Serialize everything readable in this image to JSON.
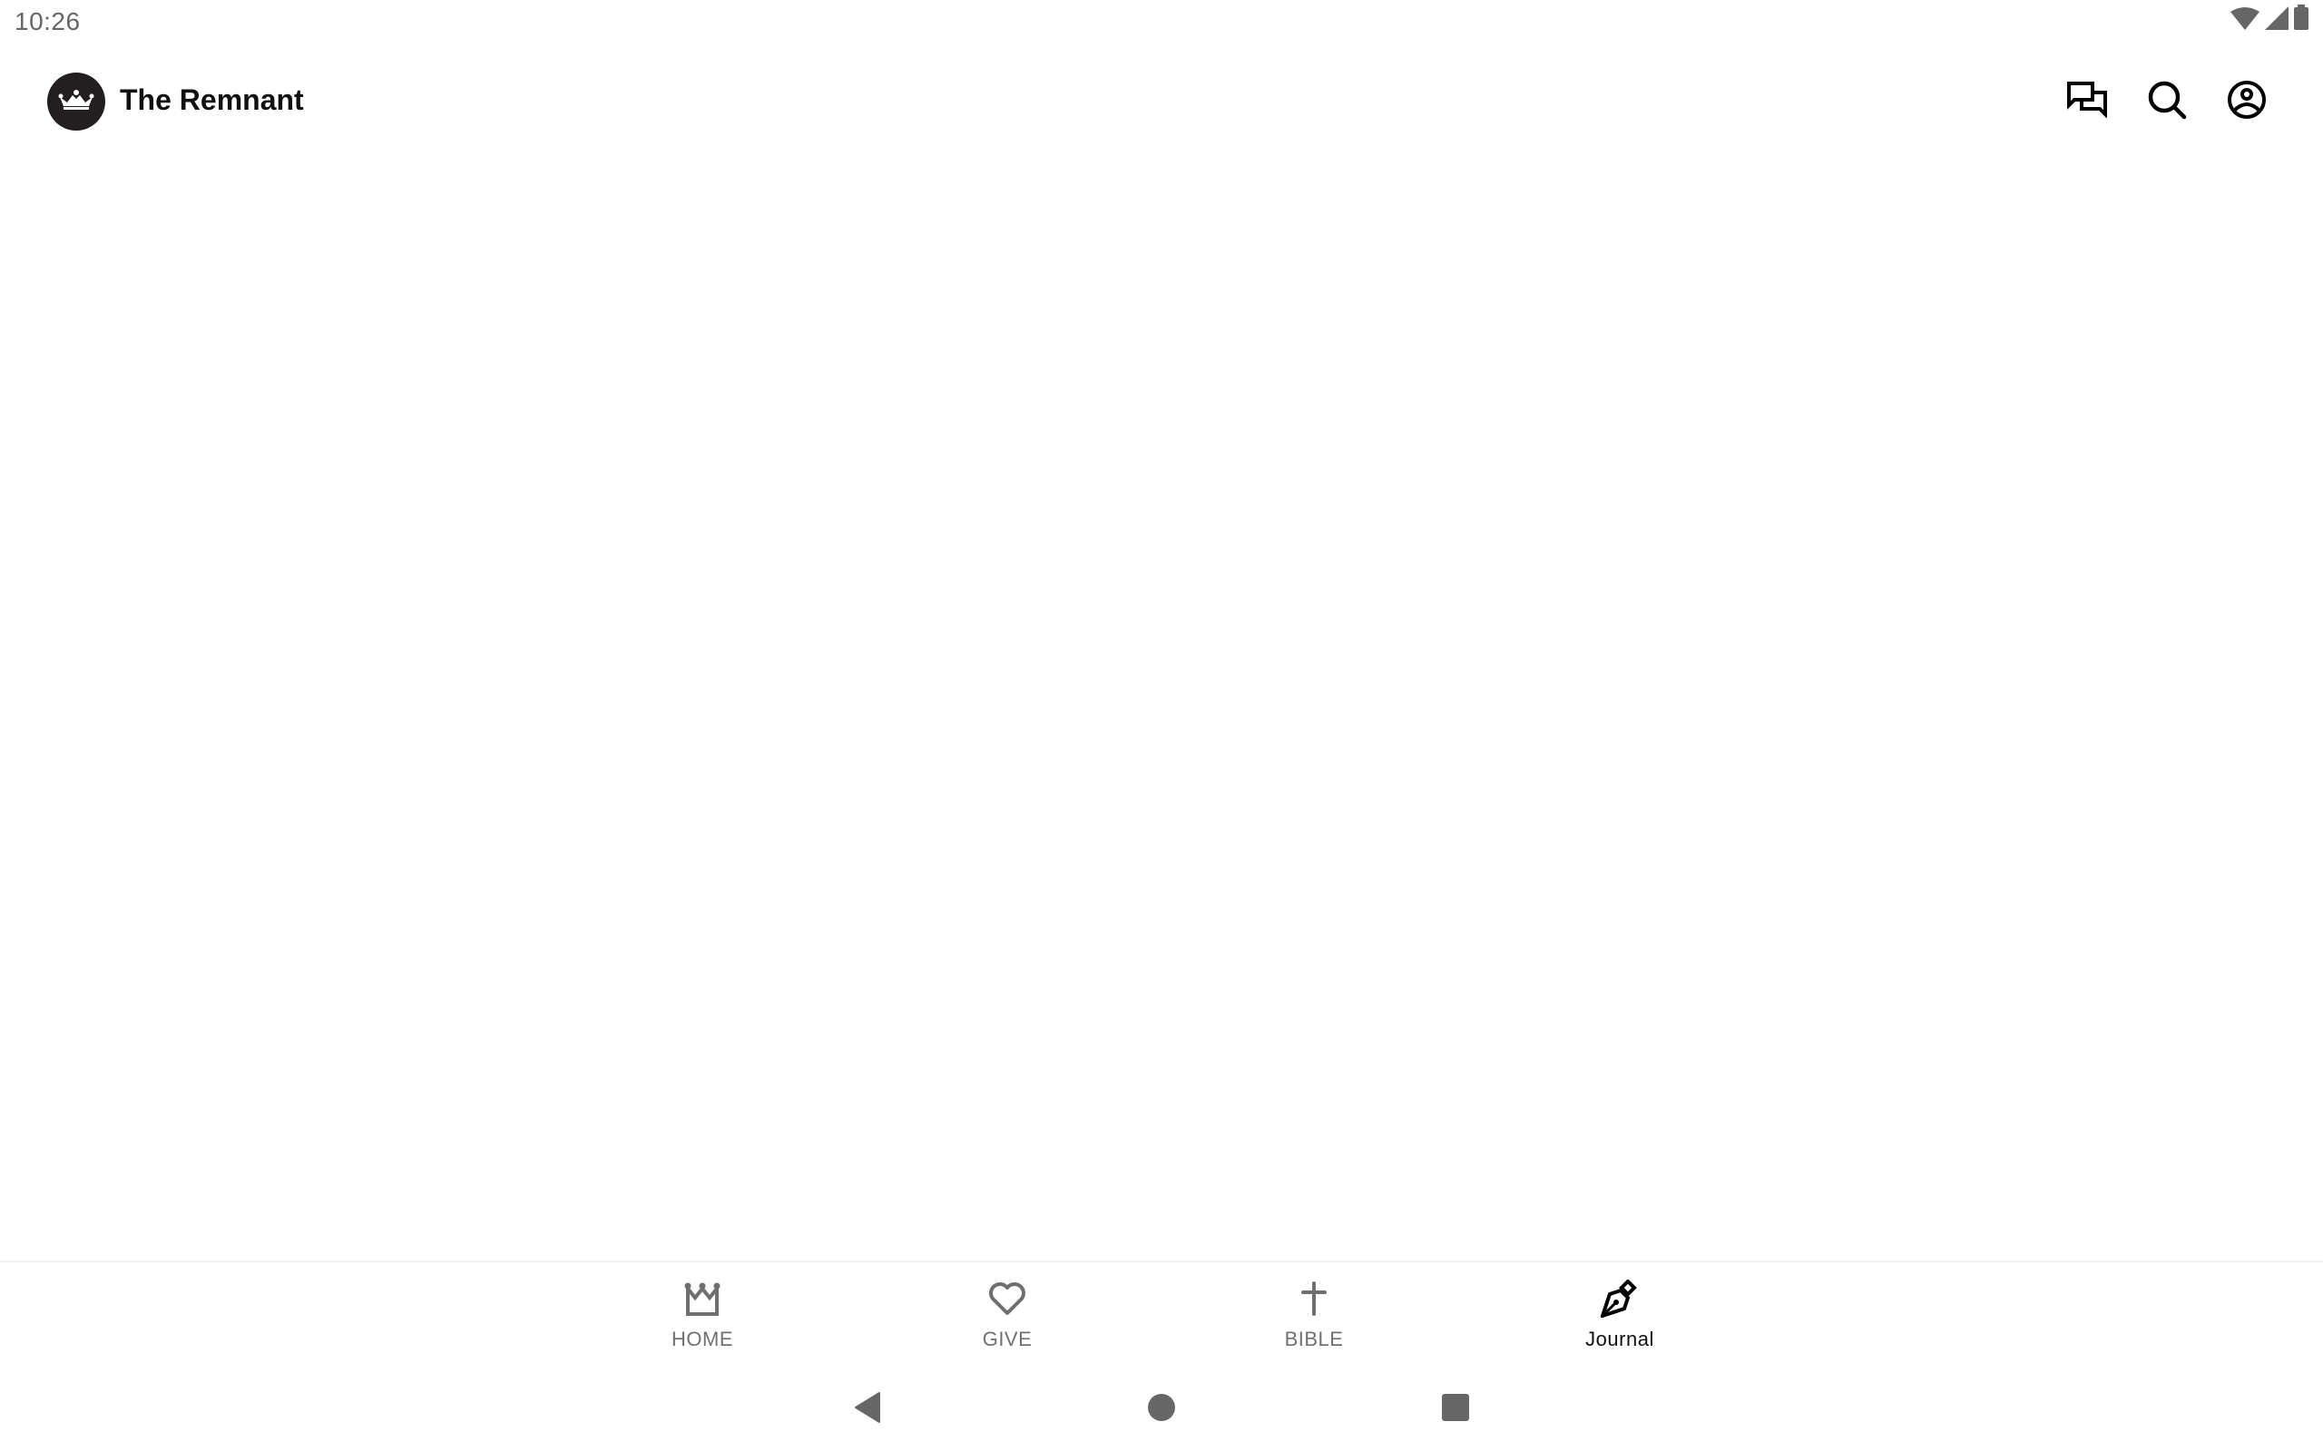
{
  "status_bar": {
    "time": "10:26",
    "icons": [
      "wifi-icon",
      "cellular-signal-icon",
      "battery-icon"
    ]
  },
  "app_bar": {
    "title": "The Remnant",
    "logo_icon": "crown-icon",
    "actions": [
      {
        "name": "chat",
        "icon": "chat-icon"
      },
      {
        "name": "search",
        "icon": "search-icon"
      },
      {
        "name": "account",
        "icon": "account-circle-icon"
      }
    ]
  },
  "bottom_nav": {
    "items": [
      {
        "label": "HOME",
        "icon": "crown-icon",
        "active": false
      },
      {
        "label": "GIVE",
        "icon": "heart-icon",
        "active": false
      },
      {
        "label": "BIBLE",
        "icon": "cross-icon",
        "active": false
      },
      {
        "label": "Journal",
        "icon": "fountain-pen-icon",
        "active": true
      }
    ],
    "active_color": "#111111",
    "inactive_color": "#707070"
  },
  "system_nav": {
    "buttons": [
      "back",
      "home",
      "recents"
    ]
  }
}
